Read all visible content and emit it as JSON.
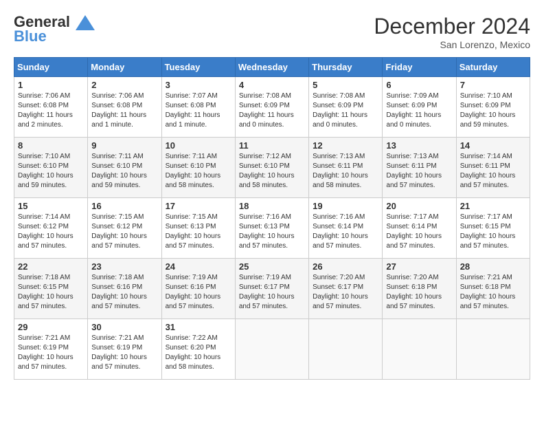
{
  "header": {
    "logo_line1": "General",
    "logo_line2": "Blue",
    "month": "December 2024",
    "location": "San Lorenzo, Mexico"
  },
  "days_of_week": [
    "Sunday",
    "Monday",
    "Tuesday",
    "Wednesday",
    "Thursday",
    "Friday",
    "Saturday"
  ],
  "weeks": [
    [
      {
        "num": "1",
        "sunrise": "7:06 AM",
        "sunset": "6:08 PM",
        "daylight": "11 hours and 2 minutes."
      },
      {
        "num": "2",
        "sunrise": "7:06 AM",
        "sunset": "6:08 PM",
        "daylight": "11 hours and 1 minute."
      },
      {
        "num": "3",
        "sunrise": "7:07 AM",
        "sunset": "6:08 PM",
        "daylight": "11 hours and 1 minute."
      },
      {
        "num": "4",
        "sunrise": "7:08 AM",
        "sunset": "6:09 PM",
        "daylight": "11 hours and 0 minutes."
      },
      {
        "num": "5",
        "sunrise": "7:08 AM",
        "sunset": "6:09 PM",
        "daylight": "11 hours and 0 minutes."
      },
      {
        "num": "6",
        "sunrise": "7:09 AM",
        "sunset": "6:09 PM",
        "daylight": "11 hours and 0 minutes."
      },
      {
        "num": "7",
        "sunrise": "7:10 AM",
        "sunset": "6:09 PM",
        "daylight": "10 hours and 59 minutes."
      }
    ],
    [
      {
        "num": "8",
        "sunrise": "7:10 AM",
        "sunset": "6:10 PM",
        "daylight": "10 hours and 59 minutes."
      },
      {
        "num": "9",
        "sunrise": "7:11 AM",
        "sunset": "6:10 PM",
        "daylight": "10 hours and 59 minutes."
      },
      {
        "num": "10",
        "sunrise": "7:11 AM",
        "sunset": "6:10 PM",
        "daylight": "10 hours and 58 minutes."
      },
      {
        "num": "11",
        "sunrise": "7:12 AM",
        "sunset": "6:10 PM",
        "daylight": "10 hours and 58 minutes."
      },
      {
        "num": "12",
        "sunrise": "7:13 AM",
        "sunset": "6:11 PM",
        "daylight": "10 hours and 58 minutes."
      },
      {
        "num": "13",
        "sunrise": "7:13 AM",
        "sunset": "6:11 PM",
        "daylight": "10 hours and 57 minutes."
      },
      {
        "num": "14",
        "sunrise": "7:14 AM",
        "sunset": "6:11 PM",
        "daylight": "10 hours and 57 minutes."
      }
    ],
    [
      {
        "num": "15",
        "sunrise": "7:14 AM",
        "sunset": "6:12 PM",
        "daylight": "10 hours and 57 minutes."
      },
      {
        "num": "16",
        "sunrise": "7:15 AM",
        "sunset": "6:12 PM",
        "daylight": "10 hours and 57 minutes."
      },
      {
        "num": "17",
        "sunrise": "7:15 AM",
        "sunset": "6:13 PM",
        "daylight": "10 hours and 57 minutes."
      },
      {
        "num": "18",
        "sunrise": "7:16 AM",
        "sunset": "6:13 PM",
        "daylight": "10 hours and 57 minutes."
      },
      {
        "num": "19",
        "sunrise": "7:16 AM",
        "sunset": "6:14 PM",
        "daylight": "10 hours and 57 minutes."
      },
      {
        "num": "20",
        "sunrise": "7:17 AM",
        "sunset": "6:14 PM",
        "daylight": "10 hours and 57 minutes."
      },
      {
        "num": "21",
        "sunrise": "7:17 AM",
        "sunset": "6:15 PM",
        "daylight": "10 hours and 57 minutes."
      }
    ],
    [
      {
        "num": "22",
        "sunrise": "7:18 AM",
        "sunset": "6:15 PM",
        "daylight": "10 hours and 57 minutes."
      },
      {
        "num": "23",
        "sunrise": "7:18 AM",
        "sunset": "6:16 PM",
        "daylight": "10 hours and 57 minutes."
      },
      {
        "num": "24",
        "sunrise": "7:19 AM",
        "sunset": "6:16 PM",
        "daylight": "10 hours and 57 minutes."
      },
      {
        "num": "25",
        "sunrise": "7:19 AM",
        "sunset": "6:17 PM",
        "daylight": "10 hours and 57 minutes."
      },
      {
        "num": "26",
        "sunrise": "7:20 AM",
        "sunset": "6:17 PM",
        "daylight": "10 hours and 57 minutes."
      },
      {
        "num": "27",
        "sunrise": "7:20 AM",
        "sunset": "6:18 PM",
        "daylight": "10 hours and 57 minutes."
      },
      {
        "num": "28",
        "sunrise": "7:21 AM",
        "sunset": "6:18 PM",
        "daylight": "10 hours and 57 minutes."
      }
    ],
    [
      {
        "num": "29",
        "sunrise": "7:21 AM",
        "sunset": "6:19 PM",
        "daylight": "10 hours and 57 minutes."
      },
      {
        "num": "30",
        "sunrise": "7:21 AM",
        "sunset": "6:19 PM",
        "daylight": "10 hours and 57 minutes."
      },
      {
        "num": "31",
        "sunrise": "7:22 AM",
        "sunset": "6:20 PM",
        "daylight": "10 hours and 58 minutes."
      },
      null,
      null,
      null,
      null
    ]
  ]
}
